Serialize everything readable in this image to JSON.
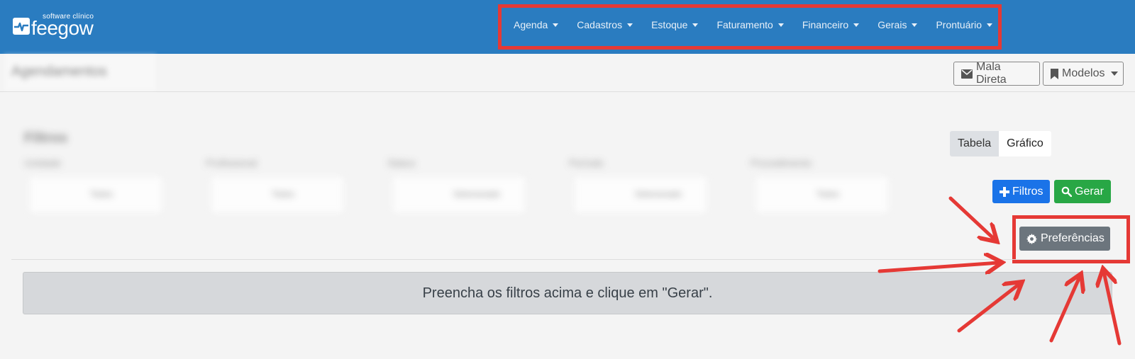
{
  "brand": {
    "tagline": "software clínico",
    "name": "feegow",
    "color": "#2a7cc0"
  },
  "nav": {
    "items": [
      {
        "label": "Agenda"
      },
      {
        "label": "Cadastros"
      },
      {
        "label": "Estoque"
      },
      {
        "label": "Faturamento"
      },
      {
        "label": "Financeiro"
      },
      {
        "label": "Gerais"
      },
      {
        "label": "Prontuário"
      }
    ]
  },
  "header": {
    "page_title": "Agendamentos",
    "mala_direta_label": "Mala Direta",
    "modelos_label": "Modelos"
  },
  "filters": {
    "title": "Filtros",
    "blocks": [
      {
        "label": "Unidade",
        "value": "Todos"
      },
      {
        "label": "Profissional",
        "value": "Todos"
      },
      {
        "label": "Status",
        "value": "Selecionado"
      },
      {
        "label": "Período",
        "value": "Selecionado"
      },
      {
        "label": "Procedimento",
        "value": "Todos"
      }
    ]
  },
  "view_toggle": {
    "tabela_label": "Tabela",
    "grafico_label": "Gráfico",
    "active": "Tabela"
  },
  "actions": {
    "filtros_label": "Filtros",
    "gerar_label": "Gerar",
    "preferencias_label": "Preferências"
  },
  "message": "Preencha os filtros acima e clique em \"Gerar\".",
  "colors": {
    "annotation_red": "#e53935",
    "primary": "#1a73e8",
    "success": "#28a745",
    "secondary": "#6c757d"
  }
}
